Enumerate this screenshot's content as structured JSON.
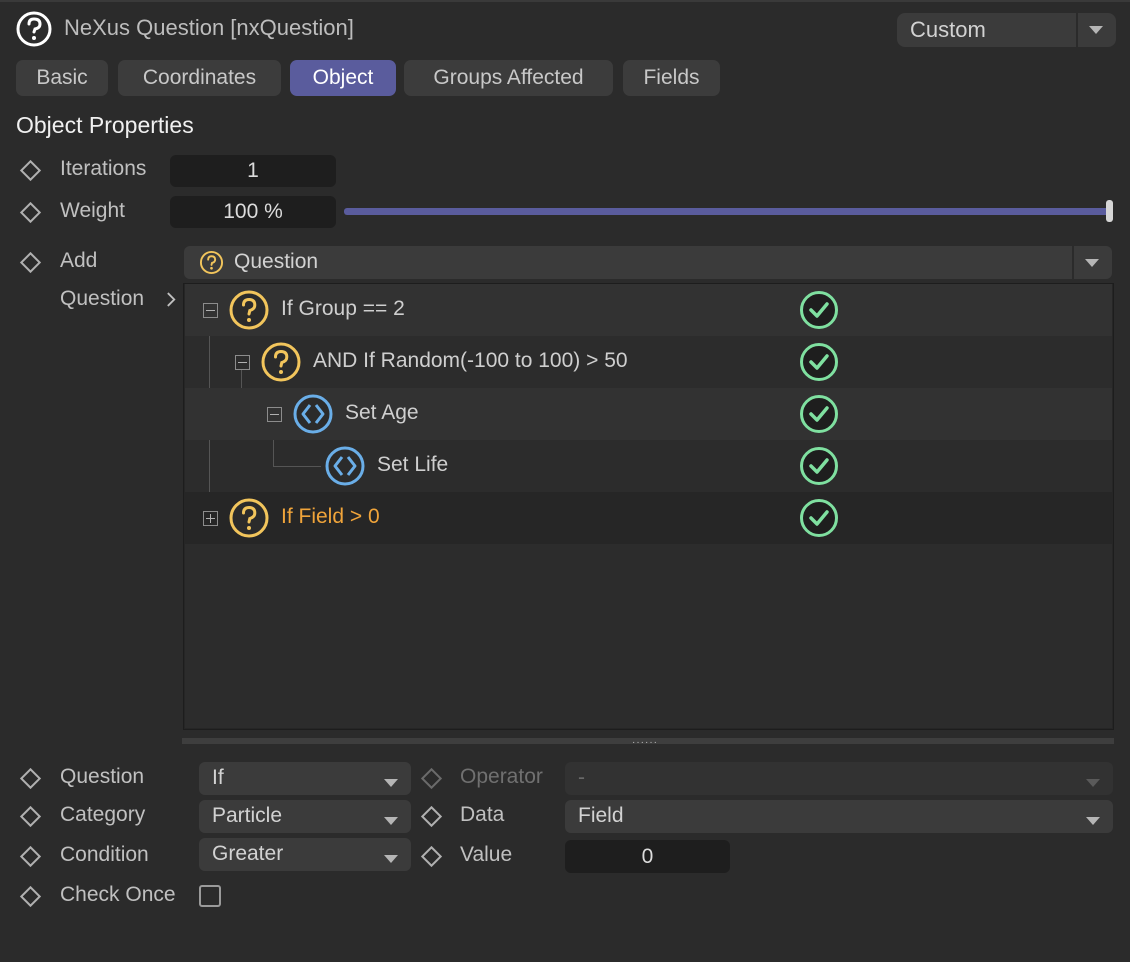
{
  "window": {
    "title": "NeXus Question [nxQuestion]",
    "preset": "Custom"
  },
  "tabs": [
    {
      "label": "Basic",
      "active": false
    },
    {
      "label": "Coordinates",
      "active": false
    },
    {
      "label": "Object",
      "active": true
    },
    {
      "label": "Groups Affected",
      "active": false
    },
    {
      "label": "Fields",
      "active": false
    }
  ],
  "section_title": "Object Properties",
  "iterations": {
    "label": "Iterations",
    "value": "1"
  },
  "weight": {
    "label": "Weight",
    "value": "100 %",
    "fraction": 1.0
  },
  "add": {
    "label": "Add",
    "value": "Question"
  },
  "question_list": {
    "label": "Question",
    "items": [
      {
        "label": "If Group == 2",
        "icon": "question-icon",
        "expander": "collapse",
        "enabled": true
      },
      {
        "label": "AND If Random(-100 to 100) > 50",
        "icon": "question-icon",
        "expander": "collapse",
        "enabled": true
      },
      {
        "label": "Set Age",
        "icon": "action-icon",
        "expander": "collapse",
        "enabled": true
      },
      {
        "label": "Set Life",
        "icon": "action-icon",
        "expander": "none",
        "enabled": true
      },
      {
        "label": "If Field > 0",
        "icon": "question-icon",
        "expander": "expand",
        "enabled": true,
        "selected": true
      }
    ]
  },
  "params": {
    "question": {
      "label": "Question",
      "value": "If"
    },
    "operator": {
      "label": "Operator",
      "value": "-"
    },
    "category": {
      "label": "Category",
      "value": "Particle"
    },
    "data": {
      "label": "Data",
      "value": "Field"
    },
    "condition": {
      "label": "Condition",
      "value": "Greater"
    },
    "value": {
      "label": "Value",
      "value": "0"
    },
    "check_once": {
      "label": "Check Once",
      "checked": false
    }
  },
  "colors": {
    "accent": "#5a5c9d",
    "question_icon": "#f2c55c",
    "action_icon": "#6aaee8",
    "enabled_check": "#7fe0a0",
    "selected_label": "#f0a43a"
  }
}
